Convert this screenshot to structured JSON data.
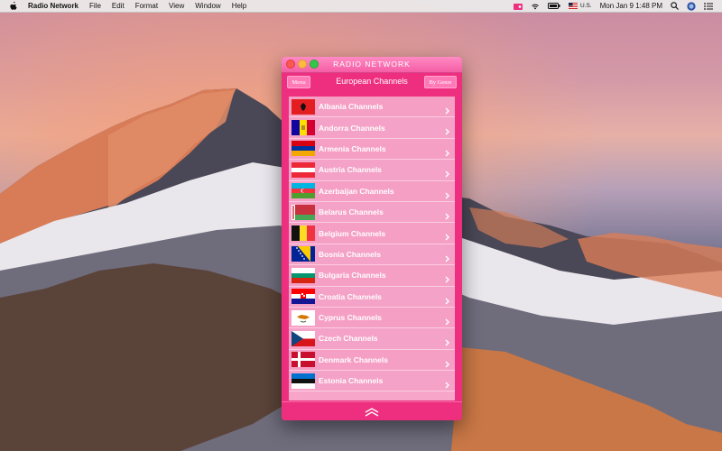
{
  "menubar": {
    "app_name": "Radio Network",
    "menus": [
      "File",
      "Edit",
      "Format",
      "View",
      "Window",
      "Help"
    ],
    "input_source": "U.S.",
    "clock": "Mon Jan 9  1:48 PM"
  },
  "window": {
    "title": "RADIO NETWORK",
    "nav_title": "European Channels",
    "menu_button": "Menu",
    "genre_button": "By Genre",
    "channels": [
      {
        "label": "Albania Channels",
        "flag": "albania"
      },
      {
        "label": "Andorra Channels",
        "flag": "andorra"
      },
      {
        "label": "Armenia Channels",
        "flag": "armenia"
      },
      {
        "label": "Austria Channels",
        "flag": "austria"
      },
      {
        "label": "Azerbaijan Channels",
        "flag": "azerbaijan"
      },
      {
        "label": "Belarus Channels",
        "flag": "belarus"
      },
      {
        "label": "Belgium Channels",
        "flag": "belgium"
      },
      {
        "label": "Bosnia Channels",
        "flag": "bosnia"
      },
      {
        "label": "Bulgaria Channels",
        "flag": "bulgaria"
      },
      {
        "label": "Croatia Channels",
        "flag": "croatia"
      },
      {
        "label": "Cyprus Channels",
        "flag": "cyprus"
      },
      {
        "label": "Czech Channels",
        "flag": "czech"
      },
      {
        "label": "Denmark Channels",
        "flag": "denmark"
      },
      {
        "label": "Estonia Channels",
        "flag": "estonia"
      }
    ]
  },
  "colors": {
    "window_pink": "#ee2f7f",
    "row_pink": "#f4a2c7",
    "title_pink": "#f45ea5"
  }
}
